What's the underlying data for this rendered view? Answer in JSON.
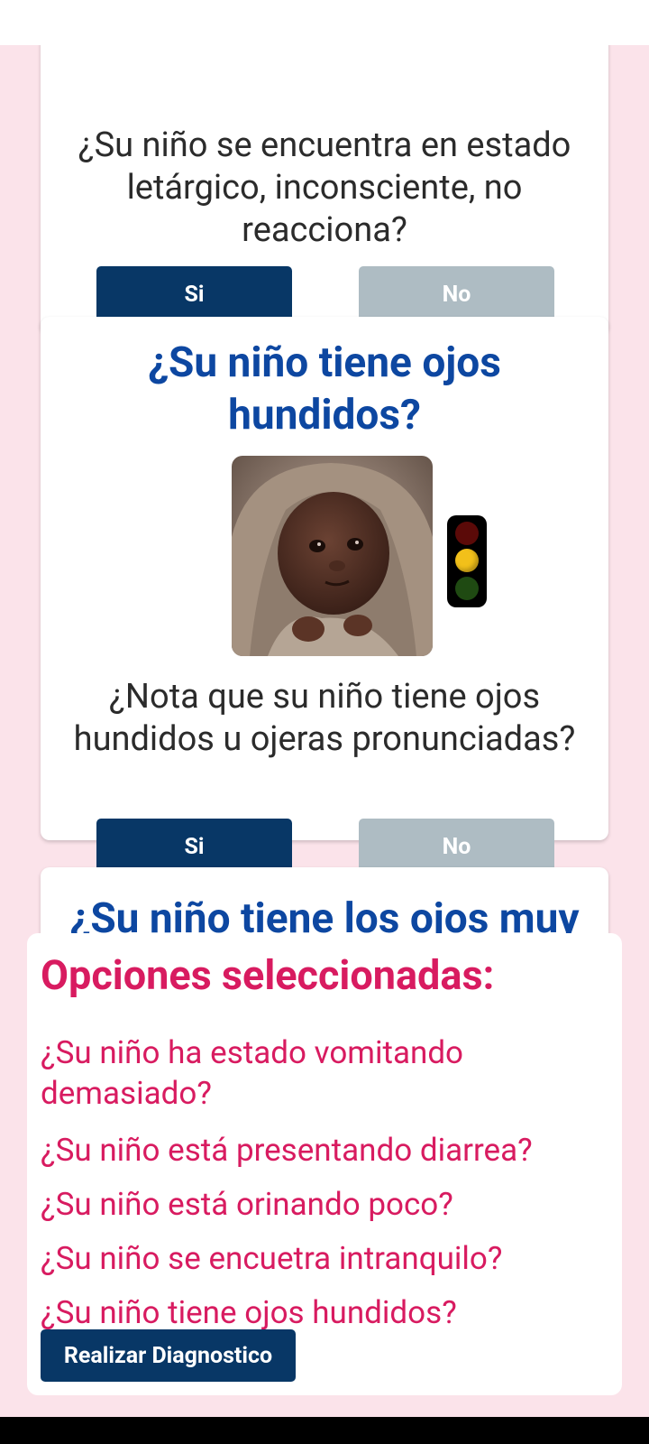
{
  "cards": [
    {
      "question": "¿Su niño se encuentra en estado letárgico, inconsciente, no reacciona?",
      "yes_label": "Si",
      "no_label": "No"
    },
    {
      "title": "¿Su niño tiene ojos hundidos?",
      "question": "¿Nota que su niño tiene ojos hundidos u ojeras pronunciadas?",
      "yes_label": "Si",
      "no_label": "No",
      "severity_indicator": "yellow"
    },
    {
      "title": "¿Su niño tiene los ojos muy"
    }
  ],
  "selected_panel": {
    "title": "Opciones seleccionadas:",
    "items": [
      "¿Su niño ha estado vomitando demasiado?",
      "¿Su niño está presentando diarrea?",
      "¿Su niño está orinando poco?",
      "¿Su niño se encuetra intranquilo?",
      "¿Su niño tiene ojos hundidos?"
    ],
    "action_label": "Realizar Diagnostico"
  },
  "colors": {
    "background": "#fbe3ea",
    "primary_button": "#083766",
    "secondary_button": "#aebcc3",
    "title_blue": "#0d47a1",
    "accent_pink": "#d81b60"
  }
}
